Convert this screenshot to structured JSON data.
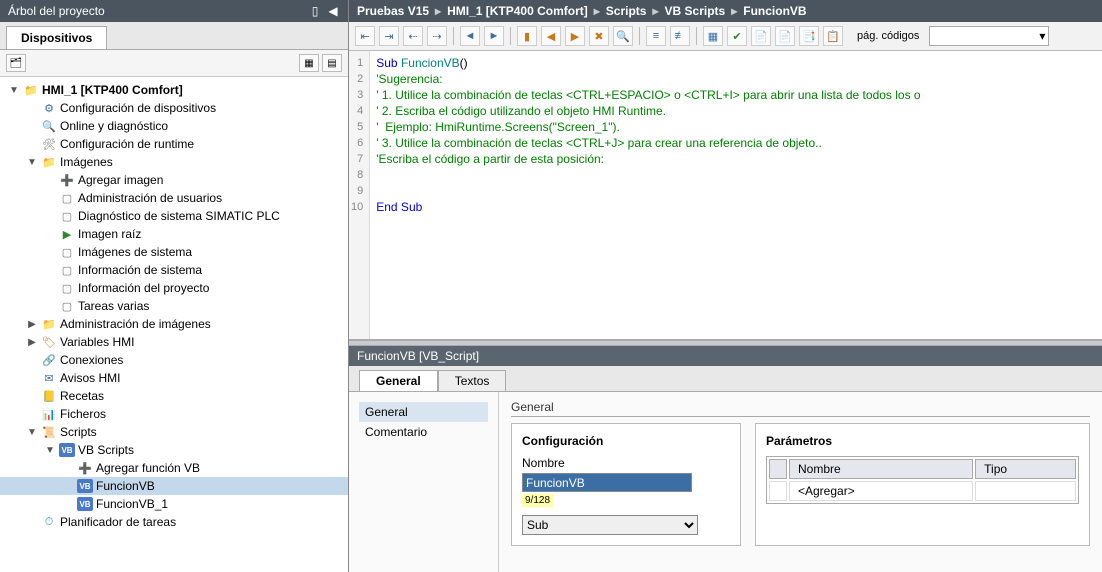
{
  "leftPane": {
    "title": "Árbol del proyecto",
    "tabLabel": "Dispositivos",
    "tree": [
      {
        "indent": 0,
        "toggle": "▼",
        "icon": "folder",
        "label": "HMI_1 [KTP400 Comfort]",
        "bold": true
      },
      {
        "indent": 1,
        "toggle": "",
        "icon": "cfg",
        "label": "Configuración de dispositivos"
      },
      {
        "indent": 1,
        "toggle": "",
        "icon": "diag",
        "label": "Online y diagnóstico"
      },
      {
        "indent": 1,
        "toggle": "",
        "icon": "rt",
        "label": "Configuración de runtime"
      },
      {
        "indent": 1,
        "toggle": "▼",
        "icon": "folder",
        "label": "Imágenes"
      },
      {
        "indent": 2,
        "toggle": "",
        "icon": "add",
        "label": "Agregar imagen"
      },
      {
        "indent": 2,
        "toggle": "",
        "icon": "screen",
        "label": "Administración de usuarios"
      },
      {
        "indent": 2,
        "toggle": "",
        "icon": "screen",
        "label": "Diagnóstico de sistema SIMATIC PLC"
      },
      {
        "indent": 2,
        "toggle": "",
        "icon": "root",
        "label": "Imagen raíz"
      },
      {
        "indent": 2,
        "toggle": "",
        "icon": "screen",
        "label": "Imágenes de sistema"
      },
      {
        "indent": 2,
        "toggle": "",
        "icon": "screen",
        "label": "Información de sistema"
      },
      {
        "indent": 2,
        "toggle": "",
        "icon": "screen",
        "label": "Información del proyecto"
      },
      {
        "indent": 2,
        "toggle": "",
        "icon": "screen",
        "label": "Tareas varias"
      },
      {
        "indent": 1,
        "toggle": "▶",
        "icon": "folder",
        "label": "Administración de imágenes"
      },
      {
        "indent": 1,
        "toggle": "▶",
        "icon": "tags",
        "label": "Variables HMI"
      },
      {
        "indent": 1,
        "toggle": "",
        "icon": "conn",
        "label": "Conexiones"
      },
      {
        "indent": 1,
        "toggle": "",
        "icon": "alarm",
        "label": "Avisos HMI"
      },
      {
        "indent": 1,
        "toggle": "",
        "icon": "recipe",
        "label": "Recetas"
      },
      {
        "indent": 1,
        "toggle": "",
        "icon": "file",
        "label": "Ficheros"
      },
      {
        "indent": 1,
        "toggle": "▼",
        "icon": "script",
        "label": "Scripts"
      },
      {
        "indent": 2,
        "toggle": "▼",
        "icon": "vb",
        "label": "VB Scripts"
      },
      {
        "indent": 3,
        "toggle": "",
        "icon": "add",
        "label": "Agregar función VB"
      },
      {
        "indent": 3,
        "toggle": "",
        "icon": "vb",
        "label": "FuncionVB",
        "selected": true
      },
      {
        "indent": 3,
        "toggle": "",
        "icon": "vb",
        "label": "FuncionVB_1"
      },
      {
        "indent": 1,
        "toggle": "",
        "icon": "plan",
        "label": "Planificador de tareas"
      }
    ]
  },
  "breadcrumb": [
    "Pruebas V15",
    "HMI_1 [KTP400 Comfort]",
    "Scripts",
    "VB Scripts",
    "FuncionVB"
  ],
  "editorToolbar": {
    "pageCodesLabel": "pág. códigos"
  },
  "code": {
    "lines": [
      [
        {
          "t": "Sub ",
          "c": "kw"
        },
        {
          "t": "FuncionVB",
          "c": "fn"
        },
        {
          "t": "()",
          "c": ""
        }
      ],
      [
        {
          "t": "'Sugerencia:",
          "c": "cm"
        }
      ],
      [
        {
          "t": "' 1. Utilice la combinación de teclas <CTRL+ESPACIO> o <CTRL+I> para abrir una lista de todos los o",
          "c": "cm"
        }
      ],
      [
        {
          "t": "' 2. Escriba el código utilizando el objeto HMI Runtime.",
          "c": "cm"
        }
      ],
      [
        {
          "t": "'  Ejemplo: HmiRuntime.Screens(\"Screen_1\").",
          "c": "cm"
        }
      ],
      [
        {
          "t": "' 3. Utilice la combinación de teclas <CTRL+J> para crear una referencia de objeto..",
          "c": "cm"
        }
      ],
      [
        {
          "t": "'Escriba el código a partir de esta posición:",
          "c": "cm"
        }
      ],
      [
        {
          "t": "",
          "c": ""
        }
      ],
      [
        {
          "t": "",
          "c": ""
        }
      ],
      [
        {
          "t": "End Sub",
          "c": "kw"
        }
      ]
    ]
  },
  "props": {
    "title": "FuncionVB [VB_Script]",
    "tabs": [
      "General",
      "Textos"
    ],
    "leftItems": [
      "General",
      "Comentario"
    ],
    "sectionHead": "General",
    "config": {
      "title": "Configuración",
      "nameLabel": "Nombre",
      "nameValue": "FuncionVB",
      "counter": "9/128",
      "typeValue": "Sub"
    },
    "params": {
      "title": "Parámetros",
      "colName": "Nombre",
      "colType": "Tipo",
      "addRow": "<Agregar>"
    }
  }
}
